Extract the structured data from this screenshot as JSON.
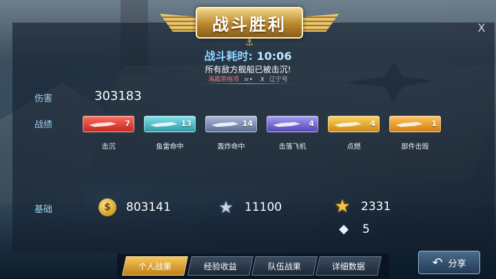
{
  "header": {
    "title": "战斗胜利",
    "close_label": "X"
  },
  "battle": {
    "time_label": "战斗耗时:",
    "time_value": "10:06",
    "message": "所有敌方舰船已被击沉!",
    "enemy": "海霹雳拖项",
    "vs_symbol": "=•",
    "x_mark": "X",
    "ally": "辽宁号"
  },
  "labels": {
    "damage": "伤害",
    "achievements": "战绩",
    "base": "基础"
  },
  "damage_value": "303183",
  "achievements": [
    {
      "label": "击沉",
      "count": "7",
      "color": "#d93a2e"
    },
    {
      "label": "鱼雷命中",
      "count": "13",
      "color": "#3bb0bd"
    },
    {
      "label": "轰炸命中",
      "count": "14",
      "color": "#7486b0"
    },
    {
      "label": "击落飞机",
      "count": "4",
      "color": "#6a5ed0"
    },
    {
      "label": "点燃",
      "count": "4",
      "color": "#e0a123"
    },
    {
      "label": "部件击毁",
      "count": "1",
      "color": "#e2941f"
    }
  ],
  "rewards": {
    "coins": "803141",
    "stars": "11100",
    "gold_stars": "2331",
    "diamonds": "5"
  },
  "icons": {
    "coin": "coin-icon",
    "star": "star-icon",
    "gold_star": "gold-star-icon",
    "diamond": "diamond-icon",
    "share": "share-arrow-icon"
  },
  "tabs": [
    {
      "label": "个人战果",
      "active": true
    },
    {
      "label": "经验收益",
      "active": false
    },
    {
      "label": "队伍战果",
      "active": false
    },
    {
      "label": "详细数据",
      "active": false
    }
  ],
  "share_label": "分享"
}
